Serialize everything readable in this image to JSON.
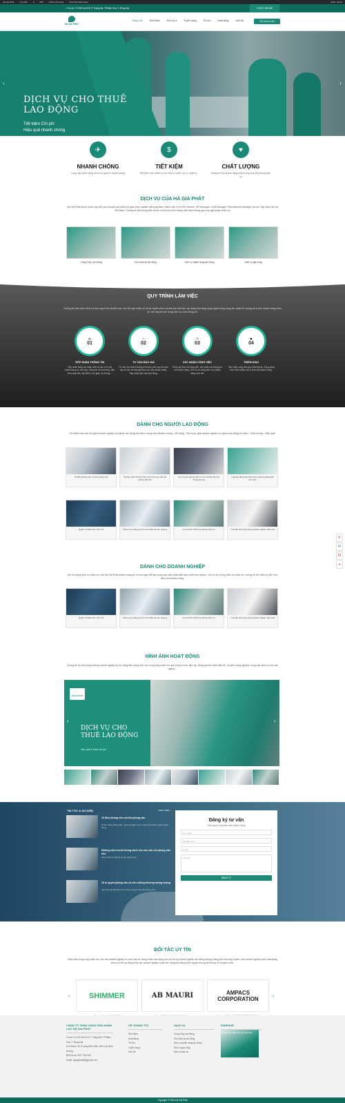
{
  "adminbar": {
    "items": [
      "Hà Gia Phát",
      "Tùy biến",
      "0",
      "Mới",
      "Chỉnh sửa trang",
      "Giới thiệu Elementor"
    ],
    "greeting": "Chào, admin"
  },
  "topbar": {
    "address": "Trụ sở: 171/32 khu Đ 5, P. Trảng Dài, TP.Biên Hòa, T. Đồng Nai",
    "hotline": "0917 180 456"
  },
  "header": {
    "logo_text": "HÀ GIA PHÁT",
    "nav": [
      "Trang chủ",
      "Giới thiệu",
      "Dịch vụ ▾",
      "Tuyển dụng",
      "Tin tức",
      "Hoạt động",
      "Liên hệ"
    ],
    "cta": "Yêu cầu tư vấn"
  },
  "hero": {
    "title": "DỊCH VỤ CHO THUÊ LAO ĐỘNG",
    "line1": "Tiết kiệm Chi phí",
    "line2": "Hiệu quả nhanh chóng"
  },
  "features": [
    {
      "title": "NHANH CHÓNG",
      "text": "Cung cấp tuyển dụng và hồ sơ giấy tờ nhanh chóng"
    },
    {
      "title": "TIẾT KIỆM",
      "text": "Tiết kiệm hơn nhiều so với việc tự tuyển, xử lý, quản lý..."
    },
    {
      "title": "CHẤT LƯỢNG",
      "text": "Mang tới cho khách hàng chất lượng cam kết phòng dịch vụ"
    }
  ],
  "services": {
    "title": "DỊCH VỤ CỦA HÀ GIA PHÁT",
    "intro": "Hà Gia Phát được thành lập bởi các chuyên gia nhân sự giàu kinh nghiệm đã từng đảm nhiệm các vị trí HR Director, HR Manager, C&B Manager, Recruitment Manager tại các Tập đoàn lớn tại Việt Nam. Chúng tôi đã không định được vị thế trên thị trường Việt Nam thông qua các giải pháp nhân sự.",
    "items": [
      "Cung Ứng Lao Động",
      "Cho thuê lại lao động",
      "Dịch vụ tuyển dụng lao động",
      "Dịch vụ gia công"
    ]
  },
  "process": {
    "title": "QUY TRÌNH LÀM VIỆC",
    "intro": "Chúng tôi vận hành dịch vụ theo quy trình chuẩn hóa, với đội ngũ nhân sự được tuyển chọn và đào tạo bài bản, áp dụng nền tảng công nghệ trong công tác quản trị, chúng tôi muốn khách hàng thực sự hài lòng khi sử dụng dịch vụ của chúng tôi.",
    "steps": [
      {
        "num": "01",
        "title": "TIẾP NHẬN THÔNG TIN",
        "text": "Tiếp nhận thông tin nhân viên và các vị trí mà khách hàng có nhu cầu; thông tin về số lượng, đặc thù công việc, địa điểm, thời gian, số lượng..."
      },
      {
        "num": "02",
        "title": "TƯ VẤN BÁO GIÁ",
        "text": "Tư vấn cho khách hàng hình thức phù hợp với yêu cầu tư vấn và báo giá theo nhu cầu khách hàng. Tiếp nhận yêu cầu hợp đồng."
      },
      {
        "num": "03",
        "title": "XÁC NHẬN CÔNG VIỆC",
        "text": "Khảo sát thực tế công việc, xác nhận các thông tin với khách hàng. Gửi hồ sơ công việc cho khách hàng xem xét."
      },
      {
        "num": "04",
        "title": "TRIỂN KHAI",
        "text": "Tiến hành công việc qua thỏa thuận. Song song thực hiện chăm sóc & theo dõi khách hàng."
      }
    ]
  },
  "workers": {
    "title": "DÀNH CHO NGƯỜI LAO ĐỘNG",
    "intro": "Sứ Mệnh lao cầu nối giữa Doanh nghiệp và nguồn lao động tìm được công việc Nhanh chóng - Dễ dàng - Phù hợp, giúp doanh nghiệp có nguồn lao động Ổn định - Chất lượng - Hiệu quả.",
    "tiles": [
      "10 điều không nên nói khi phỏng vấn",
      "Những cách trả lời thông minh cho các câu hỏi phỏng vấn khó",
      "10 bí quyết phỏng vấn có nên những thương lượng lương",
      "Luật lao động cần biết về an toàn lao động khi làm việc",
      "Quản Trị Nhân Sự Thời 4.0",
      "Chiến lược sáng tạo thu hút nhân tài cho công ty",
      "Lợi ích Khi Thuê Lao Động Thời Vụ",
      "7 sai lầm khi tuyển dụng doanh nghiệp mắc phải"
    ]
  },
  "business": {
    "title": "DÀNH CHO DOANH NGHIỆP",
    "intro": "Khi sử dụng dịch vụ nhân sự của Hà Gia Phát khách hàng sẽ có thời gian để tập trung vào việc phát triển sản xuất kinh doanh. Với cơ sở vững chắc về nhân sự, chúng tôi sẽ chăm lo đến mọi điều cho khách hàng.",
    "tiles": [
      "Quản Trị Nhân Sự Thời 4.0",
      "Chiến lược sáng tạo thu hút nhân tài cho công ty",
      "Lợi ích Khi Thuê Lao Động Thời Vụ",
      "7 sai lầm khi tuyển dụng doanh nghiệp mắc phải"
    ]
  },
  "activities": {
    "title": "HÌNH ẢNH HOẠT ĐỘNG",
    "intro": "Chúng tôi là một trong những doanh nghiệp uy tín hàng đầu trong lĩnh vực cung ứng nhân lực gia công cơ khí, lắp ráp, đóng gói linh kiện điện tử, và sinh công nghiệp, cung cấp dịch vụ cho các ngành...",
    "slide_title": "DỊCH VỤ CHO THUÊ LAO ĐỘNG",
    "slide_sub": "Hiệu quả & Giảm chi phí",
    "logo": "HÀ GIA PHÁT"
  },
  "news": {
    "header": "TIN TỨC & SỰ KIỆN",
    "more": "XEM THÊM ›",
    "items": [
      {
        "title": "10 điều không nên nói khi phỏng vấn",
        "text": "Chính sống phỏng vấn, người sẽ gặp với tư cách ứng tuyển người tuyển dụng"
      },
      {
        "title": "Những cách trả lời thông minh cho các câu hỏi phỏng vấn khó",
        "text": "Hãy chuẩn bị thật kỹ và tìm hiểu trước..."
      },
      {
        "title": "10 bí quyết phỏng vấn có nên những thương lượng lương",
        "text": "Làm thế nào để đạt mức lương mong muốn khi phỏng vấn..."
      }
    ]
  },
  "form": {
    "title": "Đăng ký tư vấn",
    "subtitle": "Giải quyết mọi thắc mắc khách hàng",
    "fields": [
      "Họ và tên",
      "Số điện thoại",
      "Email",
      "Tiêu đề"
    ],
    "submit": "ĐĂNG KÝ"
  },
  "partners": {
    "title": "ĐỐI TÁC UY TÍN",
    "intro": "Đảm bảo cung ứng nhân lực cho các doanh nghiệp có nhu cầu sử dụng nhiều lao động với số lượng doanh nghiệp lao động không mang tính thường xuyên, các doanh nghiệp mới hoạt động chưa có đủ lao động hay các doanh nghiệp muốn sử dụng lao động thuê ngoài nhưng lại không có chuyên môn.",
    "items": [
      {
        "logo": "SHIMMER",
        "caption": "Công ty cổ phần SHIMMER"
      },
      {
        "logo": "AB MAURI",
        "caption": "Công Ty TNHH AB MAURI Việt Nam"
      },
      {
        "logo": "AMPACS CORPORATION",
        "caption": "Công ty TNHH AMPACS INTERNATIONAL"
      }
    ]
  },
  "footer": {
    "company": "CÔNG TY TNHH CUNG ỨNG NHÂN LỰC HÀ GIA PHÁT",
    "contact": [
      "Trụ sở: 171/32 khu Đ 5, P. Trảng Dài, TP.Biên Hòa, T. Đồng Nai",
      "Chi nhánh: 36 Trường Đình Kinh, Bến Cát, Bình Dương",
      "Điện thoại: 0917 180 456",
      "Email: hagiaphat68@gmail.com"
    ],
    "about_title": "VỀ CHÚNG TÔI",
    "about": [
      "Giới thiệu",
      "Hoạt động",
      "Tin tức",
      "Tuyển dụng",
      "Liên hệ"
    ],
    "service_title": "DỊCH VỤ",
    "service": [
      "Cung Ứng Lao Động",
      "Cho thuê lại lao động",
      "Dịch vụ tuyển dụng lao động",
      "Dịch vụ gia công",
      "Dịch vụ bảo vệ"
    ],
    "fanpage_title": "FANPAGE",
    "fanpage_name": "Cung ứng nhân lực Hà Gia Phát",
    "copyright": "Copyright © 2021 Hà Gia Phát"
  }
}
